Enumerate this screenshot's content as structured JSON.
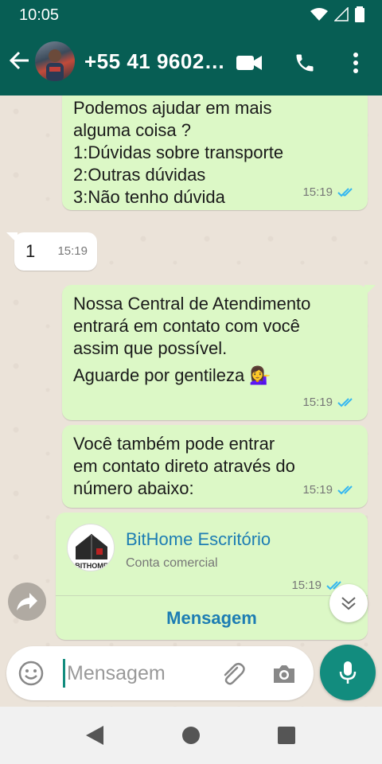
{
  "status_bar": {
    "time": "10:05"
  },
  "header": {
    "title": "+55 41 9602…"
  },
  "messages": [
    {
      "text": "Podemos ajudar em mais\nalguma coisa ?\n1:Dúvidas sobre transporte\n2:Outras dúvidas\n3:Não tenho dúvida",
      "time": "15:19"
    },
    {
      "text": "1",
      "time": "15:19"
    },
    {
      "text": "Nossa Central de Atendimento\nentrará em contato com você\nassim que possível.",
      "text2": "Aguarde por gentileza 💁‍♀️",
      "time": "15:19"
    },
    {
      "text": "Você também pode entrar\nem contato direto através do\nnúmero abaixo:",
      "time": "15:19"
    }
  ],
  "contact_card": {
    "name": "BitHome Escritório",
    "subtitle": "Conta comercial",
    "time": "15:19",
    "button_label": "Mensagem",
    "logo_text": "BITHOME"
  },
  "input": {
    "placeholder": "Mensagem"
  },
  "colors": {
    "header": "#075e54",
    "outgoing": "#dcf8c6",
    "accent": "#128c7e",
    "read_ticks": "#34b7f1"
  }
}
